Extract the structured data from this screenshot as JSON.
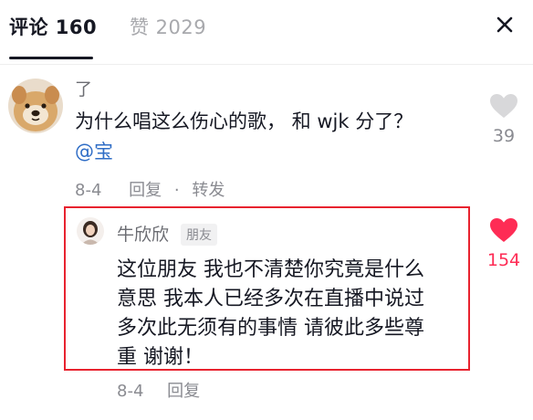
{
  "tabs": {
    "comments_label": "评论 160",
    "likes_label": "赞 2029"
  },
  "comment": {
    "username": "了",
    "text": "为什么唱这么伤心的歌， 和 wjk 分了？",
    "mention": "@宝",
    "date": "8-4",
    "reply_label": "回复",
    "separator": "·",
    "forward_label": "转发",
    "like_count": "39"
  },
  "reply": {
    "username": "牛欣欣",
    "badge": "朋友",
    "lines": [
      "这位朋友 我也不清楚你究竟是什么",
      "意思 我本人已经多次在直播中说过",
      "多次此无须有的事情 请彼此多些尊",
      "重 谢谢！"
    ],
    "date": "8-4",
    "reply_label": "回复",
    "like_count": "154"
  },
  "colors": {
    "liked_heart": "#fe2c55",
    "unliked_heart": "#d8d8da",
    "highlight_border": "#e8232f",
    "mention": "#2f6dc6"
  },
  "icons": {
    "close": "close-icon",
    "like_unliked": "heart-outline-icon",
    "like_liked": "heart-filled-icon"
  }
}
